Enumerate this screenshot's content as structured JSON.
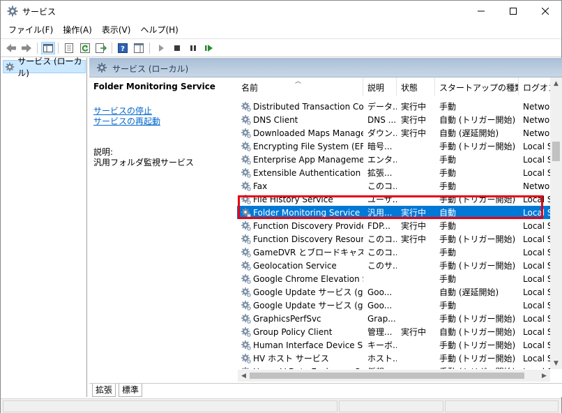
{
  "window": {
    "title": "サービス",
    "icon": "gear-icon"
  },
  "menu": [
    "ファイル(F)",
    "操作(A)",
    "表示(V)",
    "ヘルプ(H)"
  ],
  "toolbar": {
    "icons": [
      "back-arrow-icon",
      "forward-arrow-icon",
      "show-hide-tree-icon",
      "properties-icon",
      "refresh-icon",
      "export-list-icon",
      "help-icon",
      "action-pane-icon",
      "play-icon",
      "stop-icon",
      "pause-icon",
      "restart-icon"
    ]
  },
  "tree": {
    "selected_label": "サービス (ローカル)"
  },
  "header": {
    "title": "サービス (ローカル)"
  },
  "detail": {
    "service_name": "Folder Monitoring Service",
    "link_stop": "サービスの停止",
    "link_restart": "サービスの再起動",
    "description_label": "説明:",
    "description": "汎用フォルダ監視サービス"
  },
  "columns": {
    "name": "名前",
    "description": "説明",
    "status": "状態",
    "startup": "スタートアップの種類",
    "logon": "ログオン"
  },
  "rows": [
    {
      "name": "Distributed Transaction Coo...",
      "desc": "データ...",
      "status": "実行中",
      "startup": "手動",
      "logon": "Netwo"
    },
    {
      "name": "DNS Client",
      "desc": "DNS ...",
      "status": "実行中",
      "startup": "自動 (トリガー開始)",
      "logon": "Netwo"
    },
    {
      "name": "Downloaded Maps Manager",
      "desc": "ダウン...",
      "status": "実行中",
      "startup": "自動 (遅延開始)",
      "logon": "Netwo"
    },
    {
      "name": "Encrypting File System (EFS)",
      "desc": "暗号...",
      "status": "",
      "startup": "手動 (トリガー開始)",
      "logon": "Local S"
    },
    {
      "name": "Enterprise App Managemen...",
      "desc": "エンタ...",
      "status": "",
      "startup": "手動",
      "logon": "Local S"
    },
    {
      "name": "Extensible Authentication P...",
      "desc": "拡張...",
      "status": "",
      "startup": "手動",
      "logon": "Local S"
    },
    {
      "name": "Fax",
      "desc": "このコ...",
      "status": "",
      "startup": "手動",
      "logon": "Netwo"
    },
    {
      "name": "File History Service",
      "desc": "ユーザ...",
      "status": "",
      "startup": "手動 (トリガー開始)",
      "logon": "Local S"
    },
    {
      "name": "Folder Monitoring Service",
      "desc": "汎用...",
      "status": "実行中",
      "startup": "自動",
      "logon": "Local S",
      "selected": true
    },
    {
      "name": "Function Discovery Provider...",
      "desc": "FDP...",
      "status": "実行中",
      "startup": "手動",
      "logon": "Local S"
    },
    {
      "name": "Function Discovery Resourc...",
      "desc": "このコ...",
      "status": "実行中",
      "startup": "手動 (トリガー開始)",
      "logon": "Local S"
    },
    {
      "name": "GameDVR とブロードキャスト ユ...",
      "desc": "このコ...",
      "status": "",
      "startup": "手動",
      "logon": "Local S"
    },
    {
      "name": "Geolocation Service",
      "desc": "このサ...",
      "status": "",
      "startup": "手動 (トリガー開始)",
      "logon": "Local S"
    },
    {
      "name": "Google Chrome Elevation S...",
      "desc": "",
      "status": "",
      "startup": "手動",
      "logon": "Local S"
    },
    {
      "name": "Google Update サービス (gup...",
      "desc": "Goo...",
      "status": "",
      "startup": "自動 (遅延開始)",
      "logon": "Local S"
    },
    {
      "name": "Google Update サービス (gup...",
      "desc": "Goo...",
      "status": "",
      "startup": "手動",
      "logon": "Local S"
    },
    {
      "name": "GraphicsPerfSvc",
      "desc": "Grap...",
      "status": "",
      "startup": "手動 (トリガー開始)",
      "logon": "Local S"
    },
    {
      "name": "Group Policy Client",
      "desc": "管理...",
      "status": "実行中",
      "startup": "自動 (トリガー開始)",
      "logon": "Local S"
    },
    {
      "name": "Human Interface Device Ser...",
      "desc": "キーボ...",
      "status": "",
      "startup": "手動 (トリガー開始)",
      "logon": "Local S"
    },
    {
      "name": "HV ホスト サービス",
      "desc": "ホスト...",
      "status": "",
      "startup": "手動 (トリガー開始)",
      "logon": "Local S"
    },
    {
      "name": "Hyper-V Data Exchange Ser...",
      "desc": "仮想...",
      "status": "",
      "startup": "手動 (トリガー開始)",
      "logon": "Local S"
    }
  ],
  "tabs": [
    "拡張",
    "標準"
  ],
  "colors": {
    "selection": "#0078d7",
    "highlight_box": "#e60012",
    "link": "#0066cc",
    "header_band": "#b9cce0"
  }
}
